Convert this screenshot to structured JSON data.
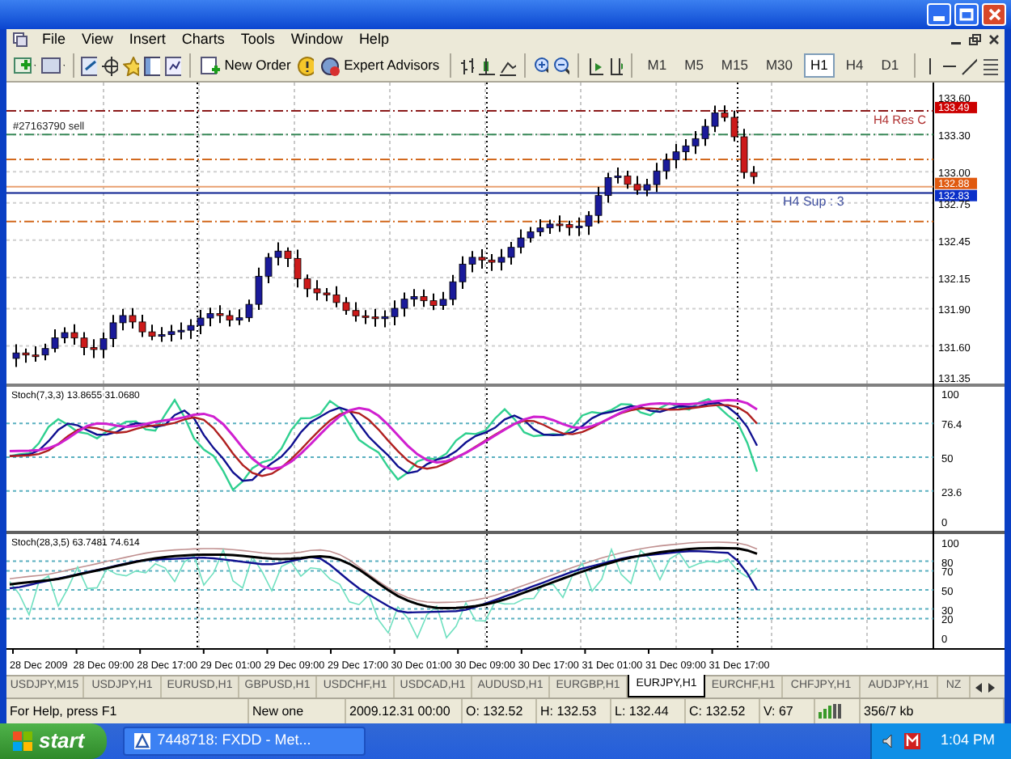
{
  "menu": [
    "File",
    "View",
    "Insert",
    "Charts",
    "Tools",
    "Window",
    "Help"
  ],
  "toolbar": {
    "buttons": [
      {
        "label": "New Order",
        "kind": "order"
      },
      {
        "label": "Expert Advisors",
        "kind": "experts"
      }
    ],
    "timeframes": [
      {
        "label": "M1",
        "selected": false
      },
      {
        "label": "M5",
        "selected": false
      },
      {
        "label": "M15",
        "selected": false
      },
      {
        "label": "M30",
        "selected": false
      },
      {
        "label": "H1",
        "selected": true
      },
      {
        "label": "H4",
        "selected": false
      },
      {
        "label": "D1",
        "selected": false
      }
    ]
  },
  "chart": {
    "order_label": "#27163790 sell",
    "levels": [
      {
        "label": "H4 Res C",
        "kind": "resistance"
      },
      {
        "label": "H4 Sup : 3",
        "kind": "support"
      }
    ],
    "price_axis": [
      {
        "text": "133.60",
        "kind": "tick"
      },
      {
        "text": "133.49",
        "kind": "marker",
        "color": "#cc0000"
      },
      {
        "text": "133.30",
        "kind": "tick"
      },
      {
        "text": "133.00",
        "kind": "tick"
      },
      {
        "text": "132.88",
        "kind": "marker",
        "color": "#e05a10"
      },
      {
        "text": "132.83",
        "kind": "marker",
        "color": "#0a2fc8"
      },
      {
        "text": "132.75",
        "kind": "tick"
      },
      {
        "text": "132.45",
        "kind": "tick"
      },
      {
        "text": "132.15",
        "kind": "tick"
      },
      {
        "text": "131.90",
        "kind": "tick"
      },
      {
        "text": "131.60",
        "kind": "tick"
      },
      {
        "text": "131.35",
        "kind": "tick"
      }
    ],
    "indicators": [
      {
        "label": "Stoch(7,3,3) 13.8655 31.0680",
        "axis": [
          "100",
          "76.4",
          "50",
          "23.6",
          "0"
        ]
      },
      {
        "label": "Stoch(28,3,5) 63.7481 74.614",
        "axis": [
          "100",
          "80",
          "70",
          "50",
          "30",
          "20",
          "0"
        ]
      }
    ],
    "time_axis": [
      "28 Dec 2009",
      "28 Dec 09:00",
      "28 Dec 17:00",
      "29 Dec 01:00",
      "29 Dec 09:00",
      "29 Dec 17:00",
      "30 Dec 01:00",
      "30 Dec 09:00",
      "30 Dec 17:00",
      "31 Dec 01:00",
      "31 Dec 09:00",
      "31 Dec 17:00"
    ]
  },
  "tabs": [
    {
      "label": "USDJPY,M15",
      "selected": false
    },
    {
      "label": "USDJPY,H1",
      "selected": false
    },
    {
      "label": "EURUSD,H1",
      "selected": false
    },
    {
      "label": "GBPUSD,H1",
      "selected": false
    },
    {
      "label": "USDCHF,H1",
      "selected": false
    },
    {
      "label": "USDCAD,H1",
      "selected": false
    },
    {
      "label": "AUDUSD,H1",
      "selected": false
    },
    {
      "label": "EURGBP,H1",
      "selected": false
    },
    {
      "label": "EURJPY,H1",
      "selected": true
    },
    {
      "label": "EURCHF,H1",
      "selected": false
    },
    {
      "label": "CHFJPY,H1",
      "selected": false
    },
    {
      "label": "AUDJPY,H1",
      "selected": false
    },
    {
      "label": "NZ",
      "selected": false
    }
  ],
  "status_bar": [
    {
      "text": "For Help, press F1",
      "kind": "text"
    },
    {
      "text": "New one",
      "kind": "text"
    },
    {
      "text": "2009.12.31 00:00",
      "kind": "text"
    },
    {
      "text": "O: 132.52",
      "kind": "text"
    },
    {
      "text": "H: 132.53",
      "kind": "text"
    },
    {
      "text": "L: 132.44",
      "kind": "text"
    },
    {
      "text": "C: 132.52",
      "kind": "text"
    },
    {
      "text": "V: 67",
      "kind": "text"
    },
    {
      "kind": "connection"
    },
    {
      "text": "356/7 kb",
      "kind": "text"
    }
  ],
  "taskbar": {
    "start": "start",
    "task": "7448718: FXDD - Met...",
    "clock": "1:04 PM"
  }
}
